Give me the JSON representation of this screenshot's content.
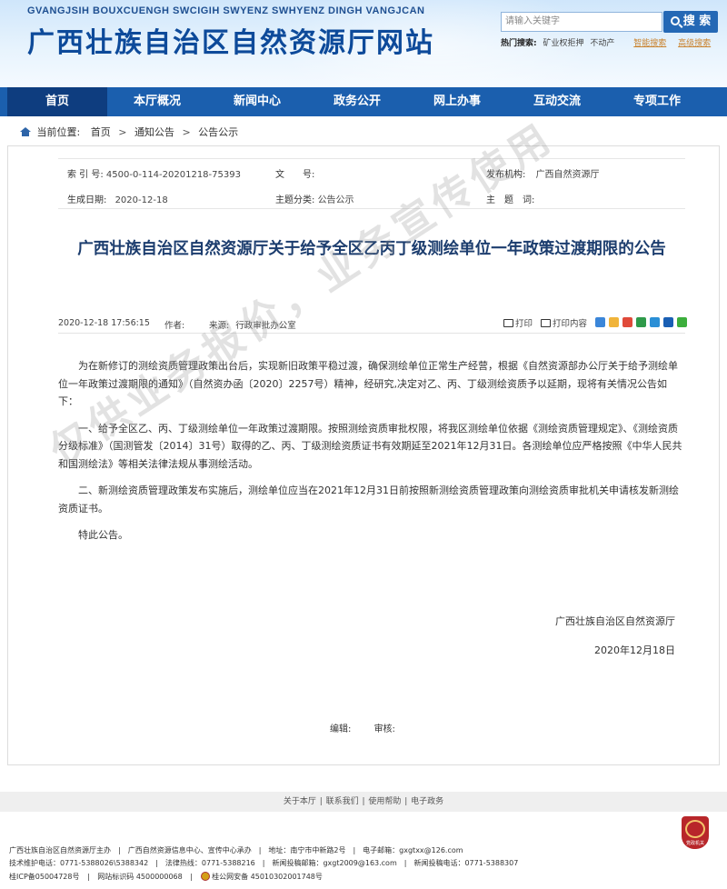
{
  "header": {
    "site_en": "GVANGJSIH BOUXCUENGH SWCIGIH SWYENZ SWHYENZ DINGH VANGJCAN",
    "site_title": "广西壮族自治区自然资源厅网站",
    "search_placeholder": "请输入关键字",
    "search_button": "搜 索",
    "hot_label": "热门搜索:",
    "hot_keywords": [
      "矿业权拒押",
      "不动产"
    ],
    "smart_search": "智能搜索",
    "advanced_search": "高级搜索"
  },
  "nav": {
    "items": [
      "首页",
      "本厅概况",
      "新闻中心",
      "政务公开",
      "网上办事",
      "互动交流",
      "专项工作"
    ],
    "active": 0
  },
  "breadcrumb": {
    "label": "当前位置:",
    "items": [
      "首页",
      "通知公告",
      "公告公示"
    ]
  },
  "meta": {
    "index_label": "索 引 号:",
    "index_value": "4500-0-114-20201218-75393",
    "doc_label": "文　　号:",
    "doc_value": "",
    "publisher_label": "发布机构:",
    "publisher_value": "广西自然资源厅",
    "date_label": "生成日期:",
    "date_value": "2020-12-18",
    "topic_label": "主题分类:",
    "topic_value": "公告公示",
    "subject_label": "主　题　词:",
    "subject_value": ""
  },
  "article": {
    "title": "广西壮族自治区自然资源厅关于给予全区乙丙丁级测绘单位一年政策过渡期限的公告",
    "datetime": "2020-12-18 17:56:15",
    "author_label": "作者:",
    "author_value": "",
    "source_label": "来源:",
    "source_value": "行政审批办公室",
    "print_label": "打印",
    "print_content_label": "打印内容",
    "paragraphs": [
      "为在新修订的测绘资质管理政策出台后，实现新旧政策平稳过渡，确保测绘单位正常生产经营，根据《自然资源部办公厅关于给予测绘单位一年政策过渡期限的通知》（自然资办函〔2020〕2257号）精神，经研究,决定对乙、丙、丁级测绘资质予以延期，现将有关情况公告如下：",
      "一、给予全区乙、丙、丁级测绘单位一年政策过渡期限。按照测绘资质审批权限，将我区测绘单位依据《测绘资质管理规定》、《测绘资质分级标准》（国测管发〔2014〕31号）取得的乙、丙、丁级测绘资质证书有效期延至2021年12月31日。各测绘单位应严格按照《中华人民共和国测绘法》等相关法律法规从事测绘活动。",
      "二、新测绘资质管理政策发布实施后，测绘单位应当在2021年12月31日前按照新测绘资质管理政策向测绘资质审批机关申请核发新测绘资质证书。",
      "特此公告。"
    ],
    "signature": "广西壮族自治区自然资源厅",
    "sign_date": "2020年12月18日",
    "editor_label": "编辑:",
    "reviewer_label": "审核:"
  },
  "watermark": "仅供业务报价，业务宣传使用",
  "footer": {
    "links": [
      "关于本厅",
      "联系我们",
      "使用帮助",
      "电子政务"
    ],
    "line1": "广西壮族自治区自然资源厅主办　|　广西自然资源信息中心、宣传中心承办　|　地址：南宁市中新路2号　|　电子邮箱：gxgtxx@126.com",
    "line2": "技术维护电话：0771-5388026\\5388342　|　法律热线：0771-5388216　|　新闻投稿邮箱：gxgt2009@163.com　|　新闻投稿电话：0771-5388307",
    "icp": "桂ICP备05004728号",
    "site_code": "网站标识码 4500000068",
    "police_record": "桂公网安备 45010302001748号",
    "badge_text": "党政机关"
  },
  "colors": {
    "nav_bg": "#1b5fae",
    "nav_active": "#0e3d7f",
    "title_blue": "#0d4a9a",
    "article_title": "#1c3d6e"
  }
}
